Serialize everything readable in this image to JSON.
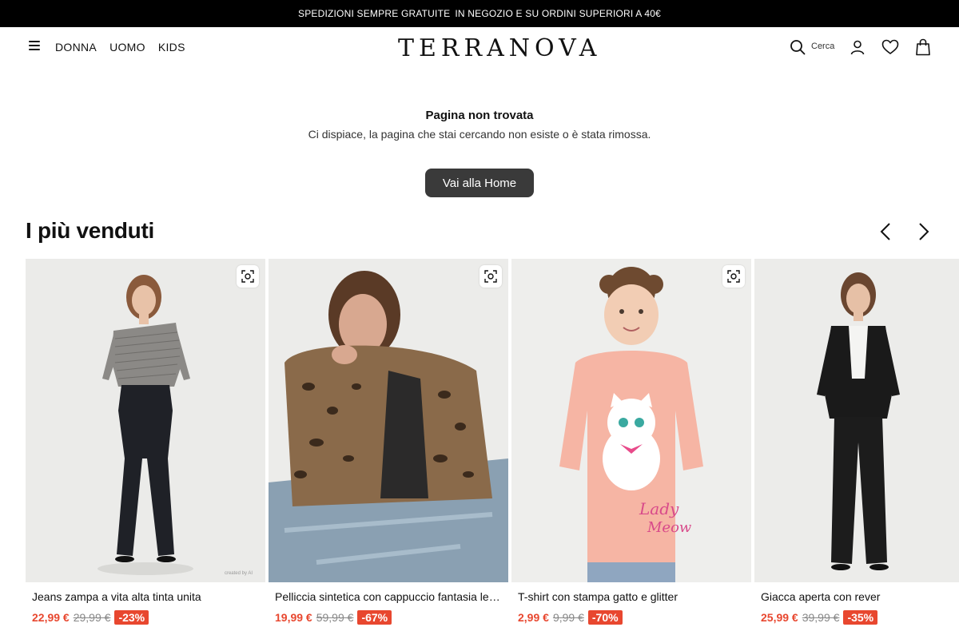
{
  "promo": {
    "part1": "SPEDIZIONI SEMPRE GRATUITE",
    "part2": "IN NEGOZIO E SU ORDINI SUPERIORI A 40€"
  },
  "header": {
    "nav": [
      "DONNA",
      "UOMO",
      "KIDS"
    ],
    "logo": "TERRANOVA",
    "search_label": "Cerca",
    "icons": [
      "search-icon",
      "account-icon",
      "heart-icon",
      "bag-icon"
    ]
  },
  "not_found": {
    "title": "Pagina non trovata",
    "text": "Ci dispiace, la pagina che stai cercando non esiste o è stata rimossa.",
    "button": "Vai alla Home"
  },
  "bestsellers": {
    "title": "I più venduti",
    "products": [
      {
        "name": "Jeans zampa a vita alta tinta unita",
        "price": "22,99 €",
        "old_price": "29,99 €",
        "discount": "-23%",
        "note": "created by AI"
      },
      {
        "name": "Pelliccia sintetica con cappuccio fantasia leopardata",
        "price": "19,99 €",
        "old_price": "59,99 €",
        "discount": "-67%"
      },
      {
        "name": "T-shirt con stampa gatto e glitter",
        "price": "2,99 €",
        "old_price": "9,99 €",
        "discount": "-70%"
      },
      {
        "name": "Giacca aperta con rever",
        "price": "25,99 €",
        "old_price": "39,99 €",
        "discount": "-35%"
      }
    ]
  },
  "colors": {
    "accent": "#e8472f",
    "promo_bg": "#000000",
    "button_bg": "#3a3a3a"
  }
}
